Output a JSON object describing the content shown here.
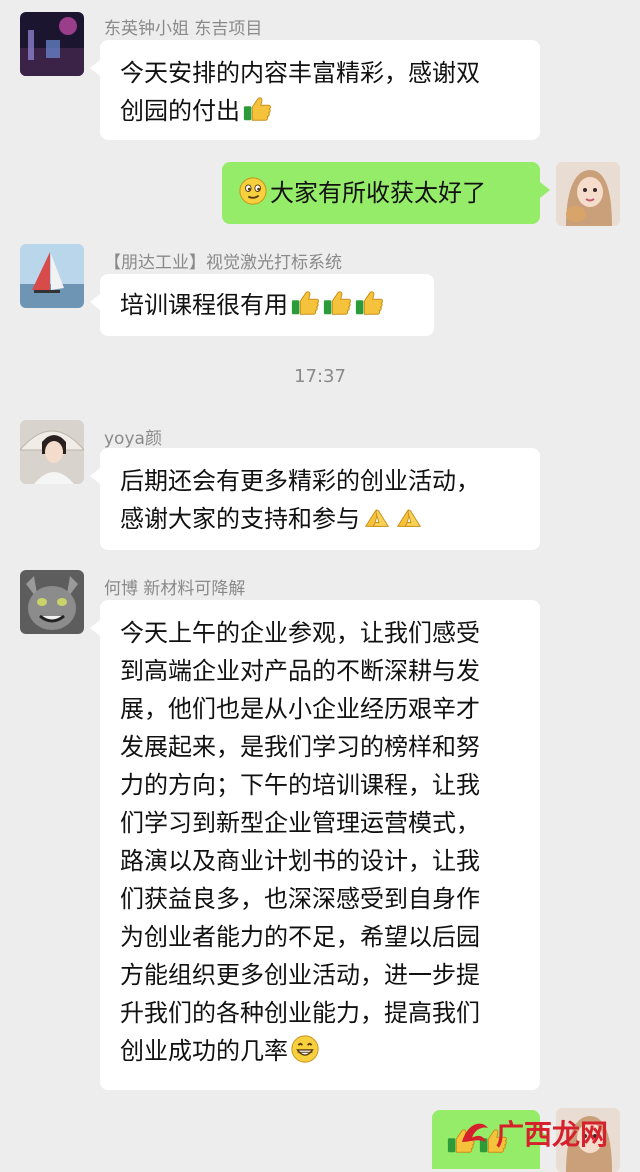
{
  "messages": [
    {
      "sender": "东英钟小姐 东吉项目",
      "lines": [
        "今天安排的内容丰富精彩，感谢双",
        "创园的付出"
      ]
    },
    {
      "text": "大家有所收获太好了"
    },
    {
      "sender": "【朋达工业】视觉激光打标系统",
      "text": "培训课程很有用"
    },
    {
      "sender": "yoya颜",
      "lines": [
        "后期还会有更多精彩的创业活动，",
        "感谢大家的支持和参与"
      ]
    },
    {
      "sender": "何博 新材料可降解",
      "lines": [
        "今天上午的企业参观，让我们感受",
        "到高端企业对产品的不断深耕与发",
        "展，他们也是从小企业经历艰辛才",
        "发展起来，是我们学习的榜样和努",
        "力的方向；下午的培训课程，让我",
        "们学习到新型企业管理运营模式，",
        "路演以及商业计划书的设计，让我",
        "们获益良多，也深深感受到自身作",
        "为创业者能力的不足，希望以后园",
        "方能组织更多创业活动，进一步提",
        "升我们的各种创业能力，提高我们",
        "创业成功的几率"
      ]
    }
  ],
  "timestamp": "17:37",
  "watermark": "广西龙网",
  "colors": {
    "background": "#ededed",
    "bubble_self": "#95ec69",
    "bubble_other": "#ffffff",
    "meta_text": "#8a8a8a"
  },
  "icons": [
    "thumbs-up-icon",
    "sly-smile-emoji-icon",
    "pray-icon",
    "grin-emoji-icon"
  ]
}
